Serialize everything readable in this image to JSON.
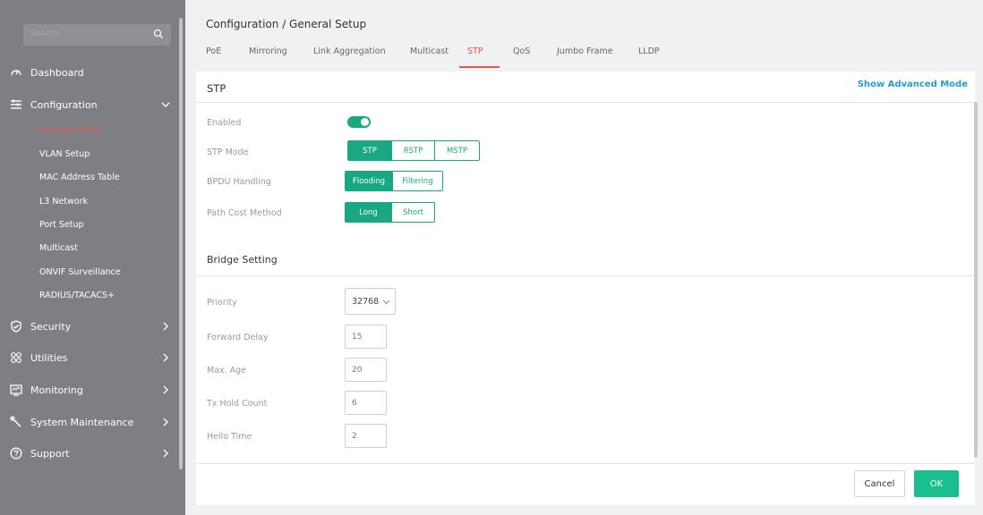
{
  "sidebar": {
    "search_placeholder": "Search",
    "items": {
      "dashboard": "Dashboard",
      "configuration": "Configuration",
      "security": "Security",
      "utilities": "Utilities",
      "monitoring": "Monitoring",
      "system_maintenance": "System Maintenance",
      "support": "Support"
    },
    "config_sub": {
      "general_setup": "General Setup",
      "vlan_setup": "VLAN Setup",
      "mac_address_table": "MAC Address Table",
      "l3_network": "L3 Network",
      "port_setup": "Port Setup",
      "multicast": "Multicast",
      "onvif": "ONVIF Surveillance",
      "radius": "RADIUS/TACACS+"
    }
  },
  "header": {
    "breadcrumb": "Configuration / General Setup"
  },
  "tabs": {
    "poe": "PoE",
    "mirroring": "Mirroring",
    "link_aggregation": "Link Aggregation",
    "multicast": "Multicast",
    "stp": "STP",
    "qos": "QoS",
    "jumbo_frame": "Jumbo Frame",
    "lldp": "LLDP",
    "active": "STP"
  },
  "stp": {
    "title": "STP",
    "advanced_link": "Show Advanced Mode",
    "enabled_label": "Enabled",
    "enabled": true,
    "mode_label": "STP Mode",
    "mode_options": {
      "stp": "STP",
      "rstp": "RSTP",
      "mstp": "MSTP"
    },
    "mode_selected": "STP",
    "bpdu_label": "BPDU Handling",
    "bpdu_options": {
      "flooding": "Flooding",
      "filtering": "Filtering"
    },
    "bpdu_selected": "Flooding",
    "path_cost_label": "Path Cost Method",
    "path_cost_options": {
      "long": "Long",
      "short": "Short"
    },
    "path_cost_selected": "Long"
  },
  "bridge": {
    "title": "Bridge Setting",
    "priority_label": "Priority",
    "priority_value": "32768",
    "forward_delay_label": "Forward Delay",
    "forward_delay_value": "15",
    "max_age_label": "Max. Age",
    "max_age_value": "20",
    "tx_hold_label": "Tx Hold Count",
    "tx_hold_value": "6",
    "hello_time_label": "Hello Time",
    "hello_time_value": "2"
  },
  "footer": {
    "cancel": "Cancel",
    "ok": "OK"
  },
  "colors": {
    "accent_green": "#19a882",
    "ok_green": "#19bf8e",
    "active_red": "#e8554e",
    "link_blue": "#1d9fd6",
    "sidebar_bg": "#7d7f83"
  }
}
